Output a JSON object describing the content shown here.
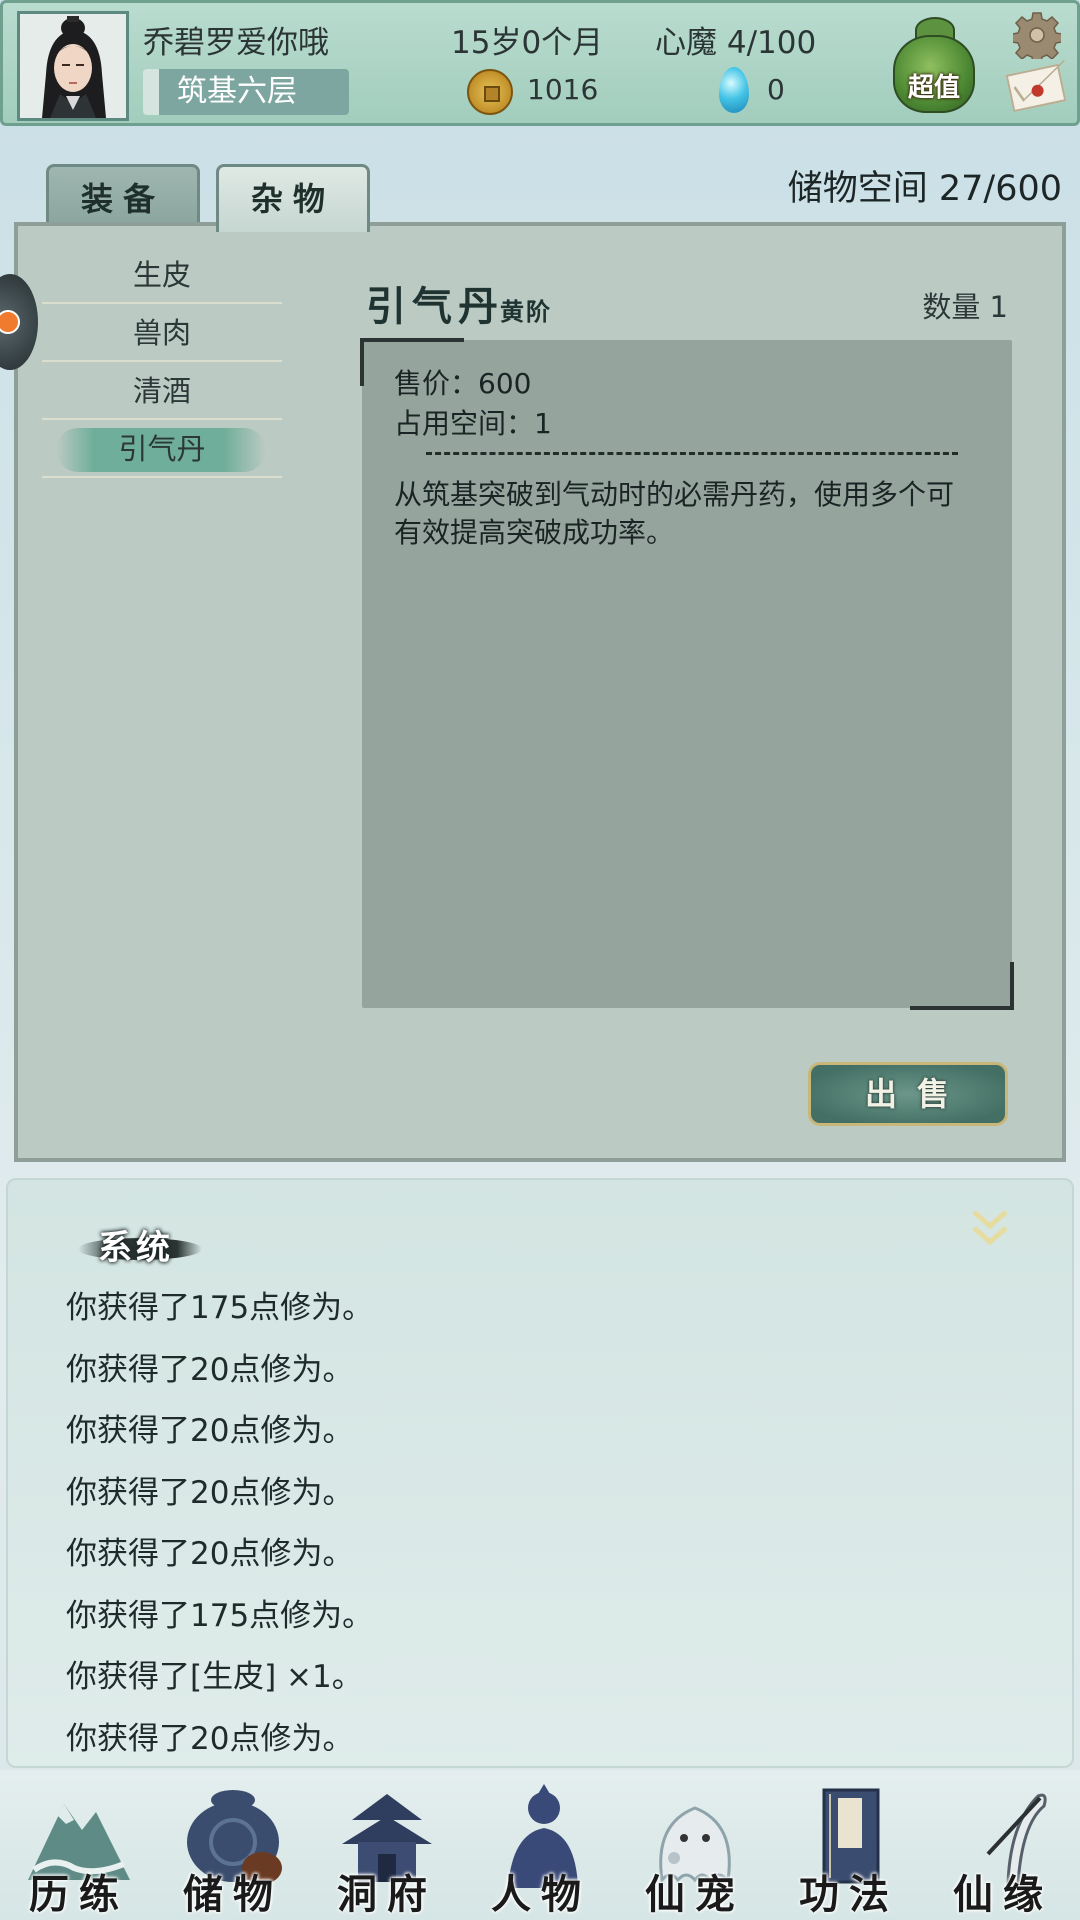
{
  "header": {
    "player_name": "乔碧罗爱你哦",
    "realm": "筑基六层",
    "age": "15岁0个月",
    "heart_demon": "心魔  4/100",
    "coins": "1016",
    "gems": "0",
    "bonus_label": "超值"
  },
  "tabs": [
    {
      "label": "装备",
      "active": false
    },
    {
      "label": "杂物",
      "active": true
    }
  ],
  "storage": {
    "capacity": "储物空间 27/600"
  },
  "items": [
    {
      "label": "生皮"
    },
    {
      "label": "兽肉"
    },
    {
      "label": "清酒"
    },
    {
      "label": "引气丹",
      "selected": true
    }
  ],
  "detail": {
    "name": "引气丹",
    "grade": "黄阶",
    "quantity": "数量 1",
    "price": "售价：600",
    "space": "占用空间：1",
    "description": "从筑基突破到气动时的必需丹药，使用多个可有效提高突破成功率。"
  },
  "sell_button": "出售",
  "log": {
    "title": "系统",
    "lines": [
      "你获得了175点修为。",
      "你获得了20点修为。",
      "你获得了20点修为。",
      "你获得了20点修为。",
      "你获得了20点修为。",
      "你获得了175点修为。",
      "你获得了[生皮] ×1。",
      "你获得了20点修为。"
    ]
  },
  "nav": [
    {
      "label": "历练",
      "icon": "mountain-icon"
    },
    {
      "label": "储物",
      "icon": "bag-icon"
    },
    {
      "label": "洞府",
      "icon": "pavilion-icon"
    },
    {
      "label": "人物",
      "icon": "person-icon"
    },
    {
      "label": "仙宠",
      "icon": "ghost-pet-icon"
    },
    {
      "label": "功法",
      "icon": "book-icon"
    },
    {
      "label": "仙缘",
      "icon": "crane-icon"
    }
  ],
  "colors": {
    "header_bg": "#a2cdbd",
    "panel_bg": "#bccac4",
    "desc_bg": "#95a59d",
    "selected_item": "#6fae9a",
    "sell_button": "#446f64"
  }
}
